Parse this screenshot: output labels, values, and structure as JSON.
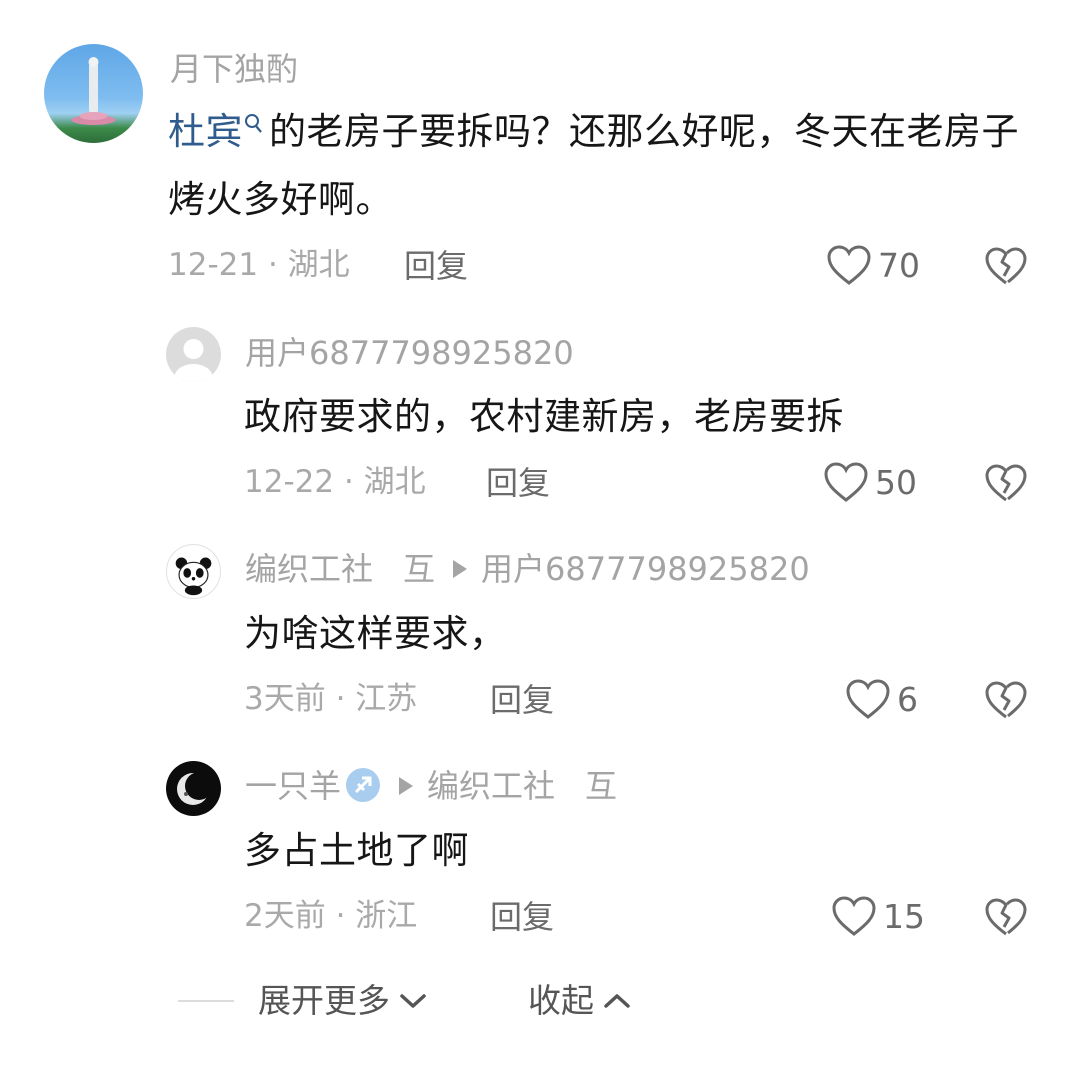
{
  "comment": {
    "username": "月下独酌",
    "mention": "杜宾",
    "text": "的老房子要拆吗？还那么好呢，冬天在老房子烤火多好啊。",
    "date": "12-21",
    "location": "湖北",
    "reply_label": "回复",
    "likes": "70",
    "avatar_icon": "guanyin-statue-avatar"
  },
  "replies": [
    {
      "username": "用户6877798925820",
      "text": "政府要求的，农村建新房，老房要拆",
      "date": "12-22",
      "location": "湖北",
      "reply_label": "回复",
      "likes": "50",
      "avatar_icon": "default-user-avatar"
    },
    {
      "username": "编织工社",
      "tag": "互",
      "reply_to": "用户6877798925820",
      "text": "为啥这样要求，",
      "date": "3天前",
      "location": "江苏",
      "reply_label": "回复",
      "likes": "6",
      "avatar_icon": "panda-avatar"
    },
    {
      "username": "一只羊",
      "reply_to": "编织工社",
      "tag": "互",
      "text": "多占土地了啊",
      "date": "2天前",
      "location": "浙江",
      "reply_label": "回复",
      "likes": "15",
      "avatar_icon": "moon-avatar"
    }
  ],
  "footer": {
    "expand_label": "展开更多",
    "collapse_label": "收起"
  },
  "colors": {
    "mention": "#2f5c8c",
    "meta": "#a9a9a9",
    "text": "#161616"
  }
}
